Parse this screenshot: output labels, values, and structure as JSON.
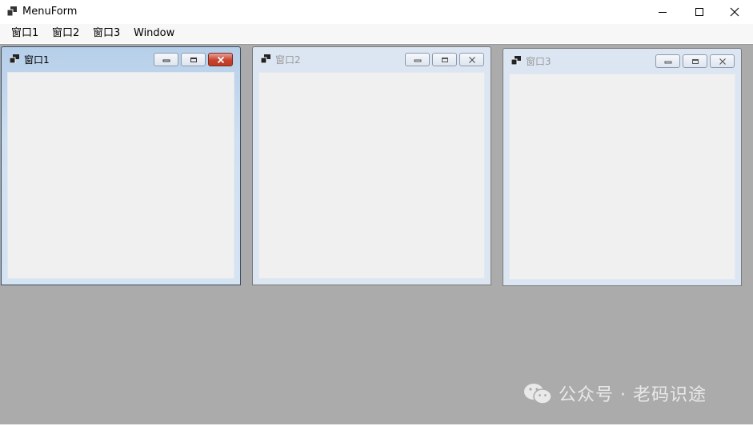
{
  "app": {
    "title": "MenuForm",
    "icon": "mdi-window-icon"
  },
  "caption_buttons": {
    "minimize": "minimize-icon",
    "maximize": "maximize-icon",
    "close": "close-icon"
  },
  "menu": {
    "items": [
      {
        "label": "窗口1"
      },
      {
        "label": "窗口2"
      },
      {
        "label": "窗口3"
      },
      {
        "label": "Window"
      }
    ]
  },
  "children": [
    {
      "title": "窗口1",
      "state": "active"
    },
    {
      "title": "窗口2",
      "state": "inactive"
    },
    {
      "title": "窗口3",
      "state": "inactive"
    }
  ],
  "watermark": {
    "text": "公众号 · 老码识途",
    "icon": "wechat-icon"
  },
  "colors": {
    "mdi_background": "#ababab",
    "active_close": "#c7432d"
  }
}
